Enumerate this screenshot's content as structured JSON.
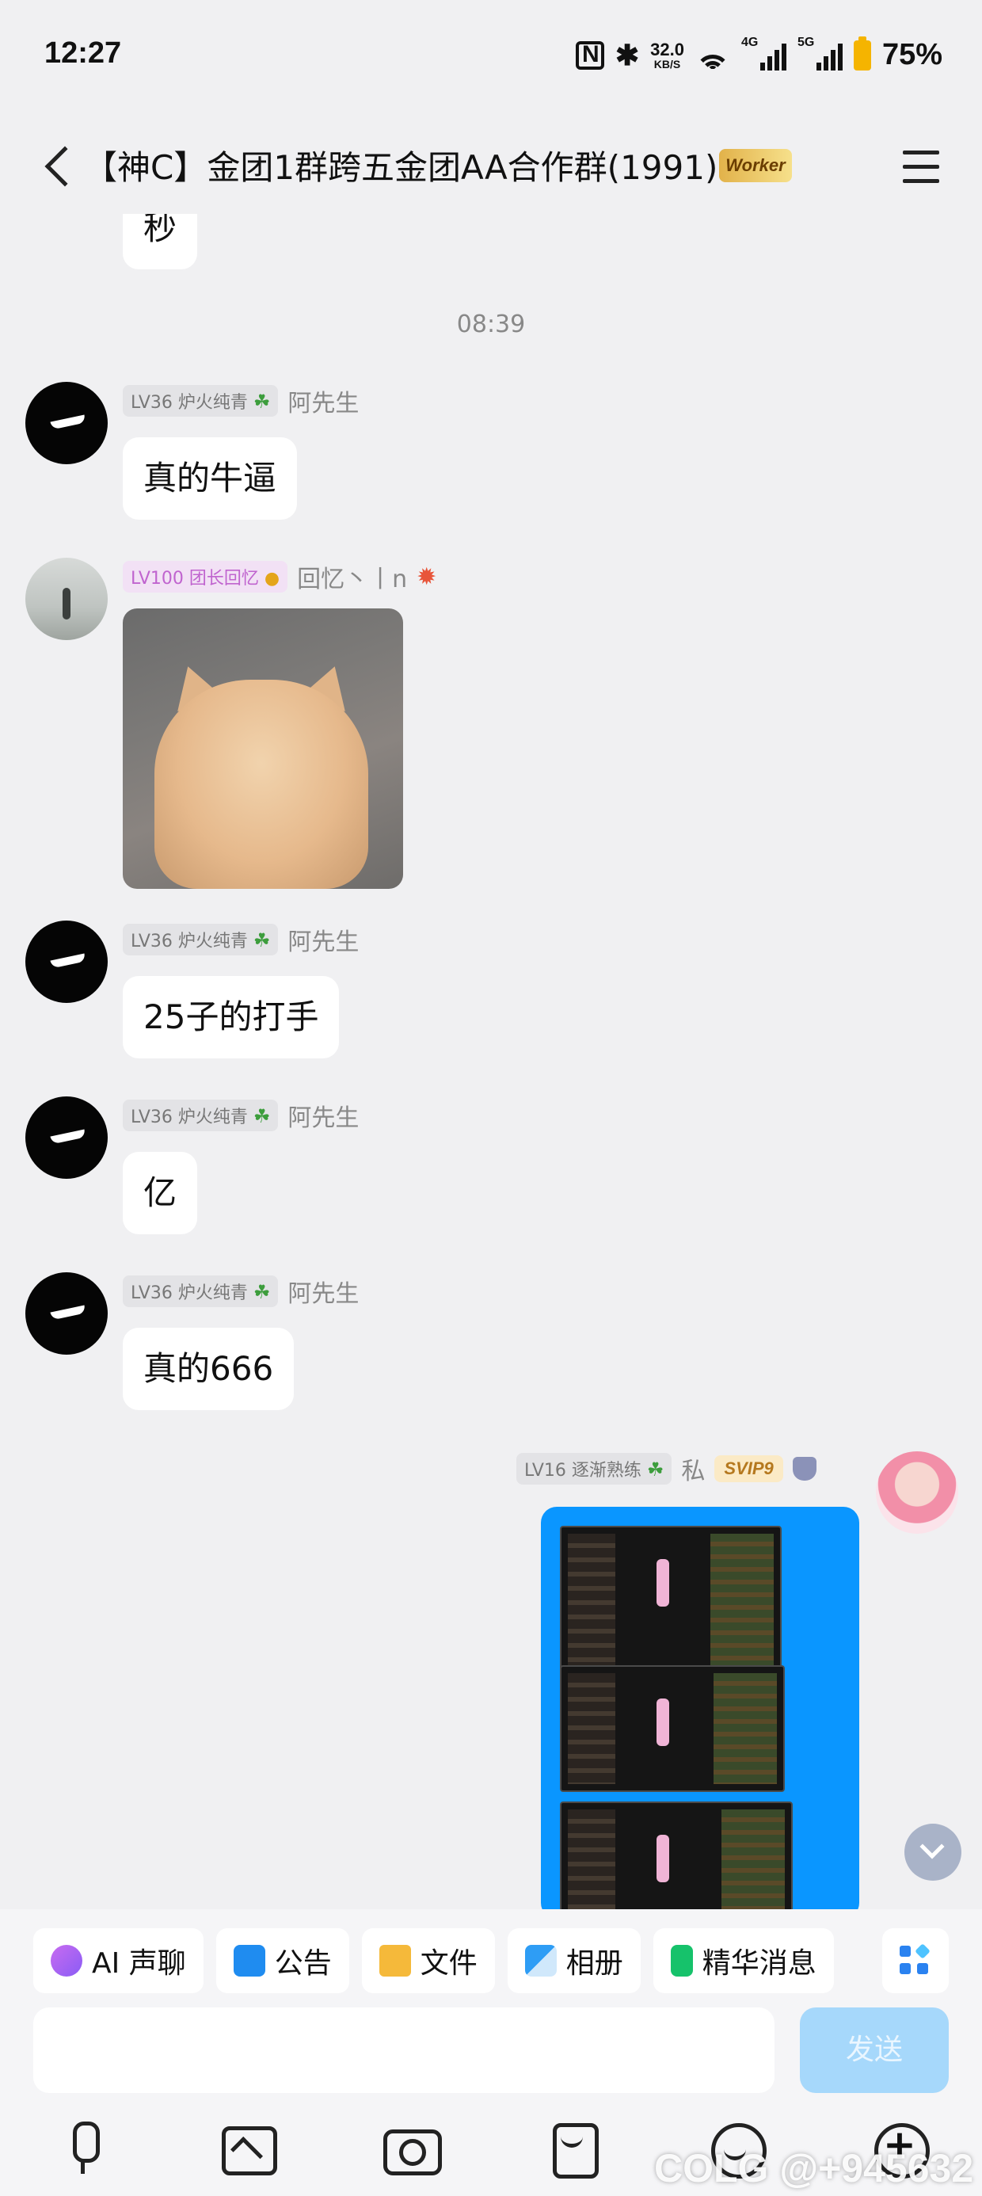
{
  "status_bar": {
    "time": "12:27",
    "network_speed": "32.0",
    "network_speed_unit": "KB/S",
    "signal_1_label": "4G",
    "signal_2_label": "5G",
    "battery": "75%"
  },
  "header": {
    "title": "【神C】金团1群跨五金团AA合作群(1991)",
    "badge": "Worker",
    "icons": [
      "back-icon",
      "menu-icon"
    ]
  },
  "messages": {
    "partial_top_text": "秒",
    "timestamp": "08:39",
    "m1": {
      "level": "LV36 炉火纯青",
      "sender": "阿先生",
      "text": "真的牛逼"
    },
    "m2": {
      "level": "LV100 团长回忆",
      "sender": "回忆丶丨n"
    },
    "m3": {
      "level": "LV36 炉火纯青",
      "sender": "阿先生",
      "text": "25子的打手"
    },
    "m4": {
      "level": "LV36 炉火纯青",
      "sender": "阿先生",
      "text": "亿"
    },
    "m5": {
      "level": "LV36 炉火纯青",
      "sender": "阿先生",
      "text": "真的666"
    },
    "m6": {
      "level": "LV16 逐渐熟练",
      "sender": "私",
      "vip": "SVIP9"
    }
  },
  "quick_actions": [
    {
      "label": "AI 声聊",
      "icon": "ai-voice-icon"
    },
    {
      "label": "公告",
      "icon": "notice-icon"
    },
    {
      "label": "文件",
      "icon": "folder-icon"
    },
    {
      "label": "相册",
      "icon": "album-icon"
    },
    {
      "label": "精华消息",
      "icon": "essence-icon"
    }
  ],
  "input": {
    "value": "",
    "placeholder": ""
  },
  "send_label": "发送",
  "watermark": "COLG @+945632",
  "colors": {
    "accent": "#0a96ff",
    "send_disabled": "#a6d8fb",
    "background": "#f0f0f2"
  }
}
